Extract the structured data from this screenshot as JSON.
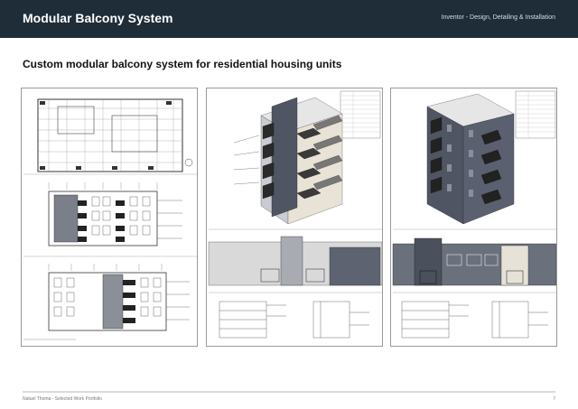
{
  "header": {
    "title": "Modular Balcony System",
    "subtitle": "Inventor - Design, Detailing & Installation"
  },
  "main": {
    "heading": "Custom modular balcony system for residential housing units",
    "sheets": [
      {
        "name": "floor-plan-and-elevations-sheet"
      },
      {
        "name": "isometric-and-detail-sheet-a"
      },
      {
        "name": "isometric-and-detail-sheet-b"
      }
    ]
  },
  "footer": {
    "credit": "Natuel Thoma - Selected Work Portfolio",
    "page_number": "7"
  },
  "colors": {
    "header_bg": "#1f2d38",
    "facade_dark": "#4f5562",
    "facade_light": "#c9ccd2",
    "balcony_dark": "#2a2a2a"
  }
}
